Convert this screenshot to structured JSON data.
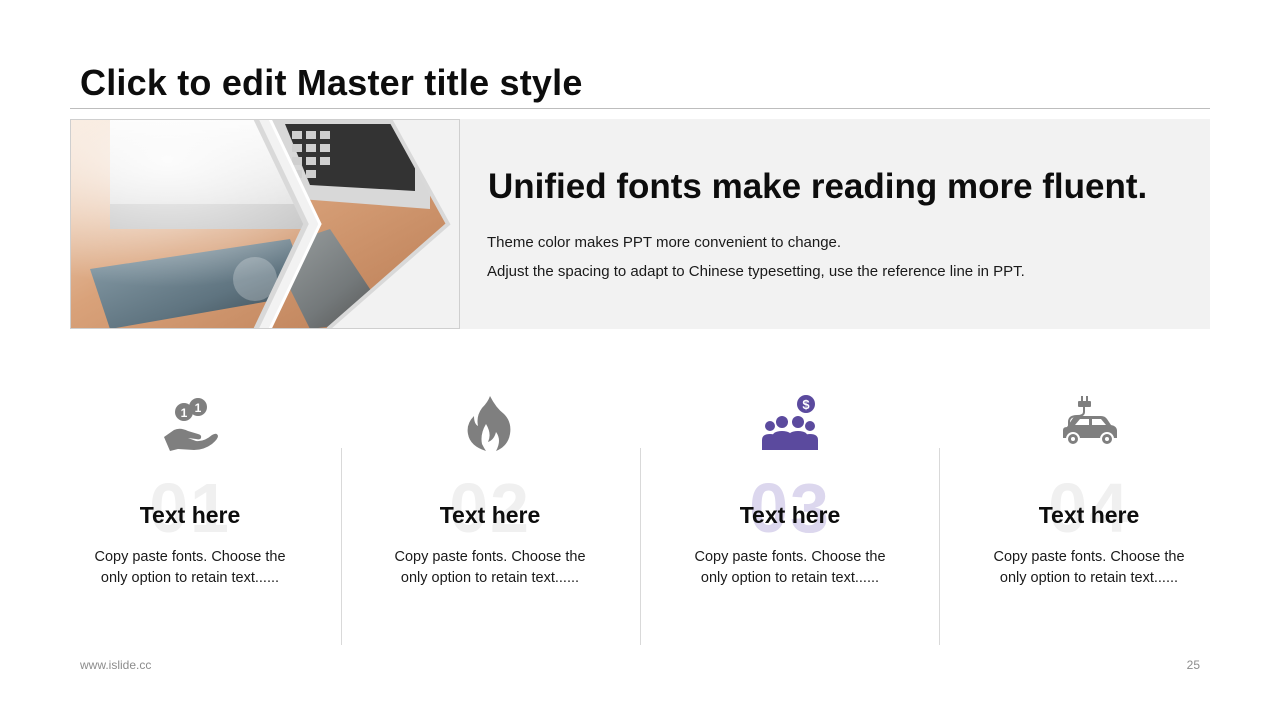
{
  "slide": {
    "title": "Click to edit Master title style",
    "banner": {
      "headline": "Unified fonts make reading more fluent.",
      "line1": "Theme color makes PPT more convenient to change.",
      "line2": "Adjust the spacing to adapt to Chinese typesetting, use the reference line in PPT."
    },
    "columns": [
      {
        "number": "01",
        "icon": "hand-coins-icon",
        "heading": "Text here",
        "body_line1": "Copy paste fonts. Choose the",
        "body_line2": "only option to retain text......"
      },
      {
        "number": "02",
        "icon": "fire-icon",
        "heading": "Text here",
        "body_line1": "Copy paste fonts. Choose the",
        "body_line2": "only option to retain text......"
      },
      {
        "number": "03",
        "icon": "team-dollar-icon",
        "heading": "Text here",
        "body_line1": "Copy paste fonts. Choose the",
        "body_line2": "only option to retain text......"
      },
      {
        "number": "04",
        "icon": "electric-car-icon",
        "heading": "Text here",
        "body_line1": "Copy paste fonts. Choose the",
        "body_line2": "only option to retain text......"
      }
    ],
    "footer": {
      "website": "www.islide.cc",
      "page_number": "25"
    }
  },
  "colors": {
    "accent": "#5b4a9e",
    "accent_light": "#dcd7ee",
    "icon_gray": "#7f7f7f",
    "banner_bg": "#f2f2f2",
    "rule": "#bdbdbd"
  }
}
